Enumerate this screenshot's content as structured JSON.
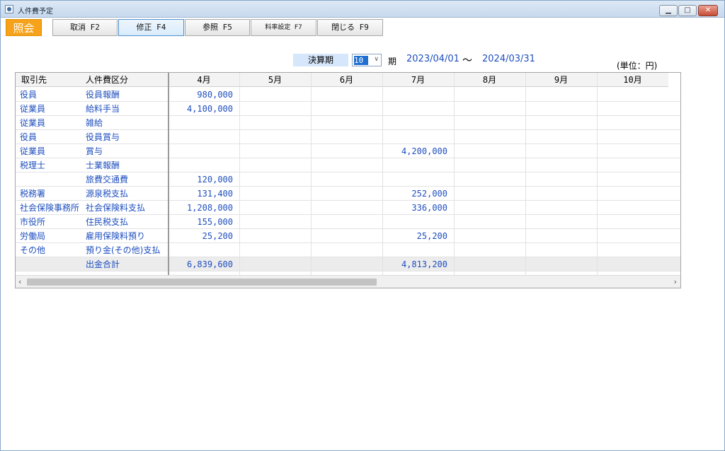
{
  "window": {
    "title": "人件費予定"
  },
  "toolbar": {
    "mode": "照会",
    "buttons": [
      "取消 F2",
      "修正 F4",
      "参照 F5",
      "料率設定 F7",
      "閉じる F9"
    ]
  },
  "period": {
    "label": "決算期",
    "value": "10",
    "suffix": "期",
    "start": "2023/04/01",
    "tilde": "～",
    "end": "2024/03/31",
    "unit": "(単位：円)"
  },
  "table": {
    "headers": [
      "取引先",
      "人件費区分",
      "4月",
      "5月",
      "6月",
      "7月",
      "8月",
      "9月",
      "10月"
    ],
    "rows": [
      [
        "役員",
        "役員報酬",
        "980,000",
        "",
        "",
        "",
        "",
        "",
        ""
      ],
      [
        "従業員",
        "給料手当",
        "4,100,000",
        "",
        "",
        "",
        "",
        "",
        ""
      ],
      [
        "従業員",
        "雑給",
        "",
        "",
        "",
        "",
        "",
        "",
        ""
      ],
      [
        "役員",
        "役員賞与",
        "",
        "",
        "",
        "",
        "",
        "",
        ""
      ],
      [
        "従業員",
        "賞与",
        "",
        "",
        "",
        "4,200,000",
        "",
        "",
        ""
      ],
      [
        "税理士",
        "士業報酬",
        "",
        "",
        "",
        "",
        "",
        "",
        ""
      ],
      [
        "",
        "旅費交通費",
        "120,000",
        "",
        "",
        "",
        "",
        "",
        ""
      ],
      [
        "税務署",
        "源泉税支払",
        "131,400",
        "",
        "",
        "252,000",
        "",
        "",
        ""
      ],
      [
        "社会保険事務所",
        "社会保険料支払",
        "1,208,000",
        "",
        "",
        "336,000",
        "",
        "",
        ""
      ],
      [
        "市役所",
        "住民税支払",
        "155,000",
        "",
        "",
        "",
        "",
        "",
        ""
      ],
      [
        "労働局",
        "雇用保険料預り",
        "25,200",
        "",
        "",
        "25,200",
        "",
        "",
        ""
      ],
      [
        "その他",
        "預り金(その他)支払",
        "",
        "",
        "",
        "",
        "",
        "",
        ""
      ]
    ],
    "total": [
      "",
      "出金合計",
      "6,839,600",
      "",
      "",
      "4,813,200",
      "",
      "",
      ""
    ]
  },
  "colors": {
    "mode_badge": "#f6a21a",
    "text_blue": "#1f4fbf",
    "period_label_bg": "#d6e6fb"
  }
}
